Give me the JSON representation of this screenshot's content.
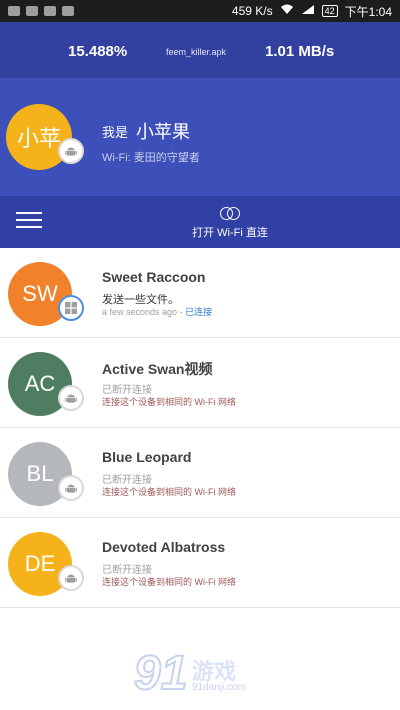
{
  "statusbar": {
    "speed": "459 K/s",
    "battery": "42",
    "time": "下午1:04"
  },
  "transfer": {
    "percent": "15.488%",
    "filename": "feem_killer.apk",
    "speed": "1.01 MB/s"
  },
  "profile": {
    "avatar_text": "小苹",
    "prefix": "我是",
    "name": "小苹果",
    "subtitle": "Wi-Fi: 麦田的守望者",
    "avatar_color": "#f6b21a"
  },
  "toolbar": {
    "wifi_direct_label": "打开 Wi-Fi 直连"
  },
  "devices": [
    {
      "initials": "SW",
      "name": "Sweet Raccoon",
      "line1": "发送一些文件。",
      "status_time": "a few seconds ago",
      "status_sep": " - ",
      "status_link": "已连接",
      "color": "#f1822b",
      "os_icon": "windows-icon"
    },
    {
      "initials": "AC",
      "name": "Active Swan视频",
      "line1": "已断开连接",
      "line2": "连接这个设备到相同的 Wi-Fi 网络",
      "color": "#4f7d61",
      "os_icon": "android-icon"
    },
    {
      "initials": "BL",
      "name": "Blue Leopard",
      "line1": "已断开连接",
      "line2": "连接这个设备到相同的 Wi-Fi 网络",
      "color": "#b4b8bc",
      "os_icon": "android-icon"
    },
    {
      "initials": "DE",
      "name": "Devoted Albatross",
      "line1": "已断开连接",
      "line2": "连接这个设备到相同的 Wi-Fi 网络",
      "color": "#f6b21a",
      "os_icon": "android-icon"
    }
  ],
  "watermark": {
    "logo": "91",
    "text": "游戏",
    "url": "91danji.com"
  },
  "colors": {
    "transfer_bar": "#3240a0",
    "profile_bg": "#3d4fb8",
    "toolbar_bg": "#3040a5",
    "link_blue": "#2e7dd1",
    "hint_red": "#a05a5a"
  }
}
